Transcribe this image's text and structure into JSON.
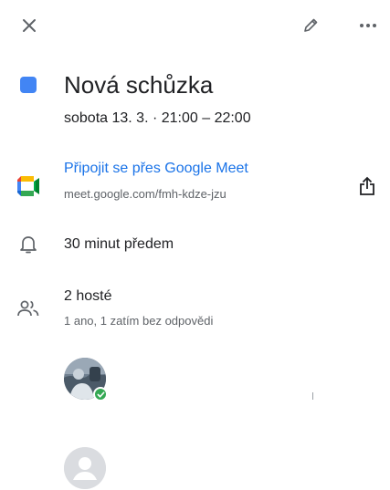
{
  "toolbar": {
    "close_icon": "close-icon",
    "edit_icon": "pencil-icon",
    "more_icon": "more-horizontal-icon"
  },
  "event": {
    "color": "#4285f4",
    "title": "Nová schůzka",
    "datetime": "sobota 13. 3. · 21:00 – 22:00"
  },
  "conference": {
    "icon": "google-meet-icon",
    "join_label": "Připojit se přes Google Meet",
    "url": "meet.google.com/fmh-kdze-jzu",
    "share_icon": "share-icon"
  },
  "notification": {
    "icon": "bell-icon",
    "label": "30 minut předem"
  },
  "guests": {
    "icon": "people-icon",
    "title": "2 hosté",
    "summary": "1 ano, 1 zatím bez odpovědi",
    "list": [
      {
        "avatar": "photo-avatar",
        "status": "accepted"
      },
      {
        "avatar": "default-avatar",
        "status": "no-response"
      }
    ]
  },
  "colors": {
    "link": "#1a73e8",
    "secondary_text": "#5f6368",
    "accepted": "#34a853"
  }
}
